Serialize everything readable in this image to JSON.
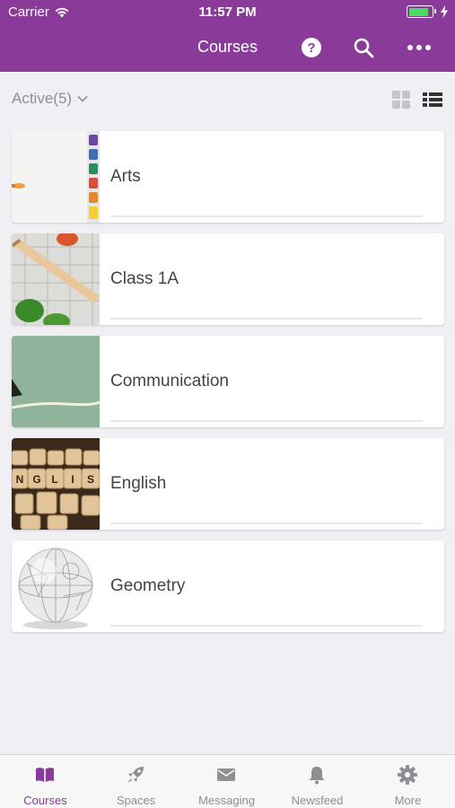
{
  "status_bar": {
    "carrier": "Carrier",
    "time": "11:57 PM"
  },
  "nav": {
    "title": "Courses"
  },
  "filter": {
    "label": "Active(5)"
  },
  "courses": [
    {
      "name": "Arts",
      "thumb": "paint-palette"
    },
    {
      "name": "Class 1A",
      "thumb": "pencil-grid"
    },
    {
      "name": "Communication",
      "thumb": "green-board"
    },
    {
      "name": "English",
      "thumb": "letter-blocks"
    },
    {
      "name": "Geometry",
      "thumb": "sphere"
    }
  ],
  "tabs": [
    {
      "label": "Courses",
      "icon": "book-icon",
      "active": true
    },
    {
      "label": "Spaces",
      "icon": "rocket-icon",
      "active": false
    },
    {
      "label": "Messaging",
      "icon": "envelope-icon",
      "active": false
    },
    {
      "label": "Newsfeed",
      "icon": "bell-icon",
      "active": false
    },
    {
      "label": "More",
      "icon": "gear-icon",
      "active": false
    }
  ],
  "colors": {
    "brand": "#8a3a98",
    "background": "#efeff4",
    "battery": "#4cd964"
  }
}
